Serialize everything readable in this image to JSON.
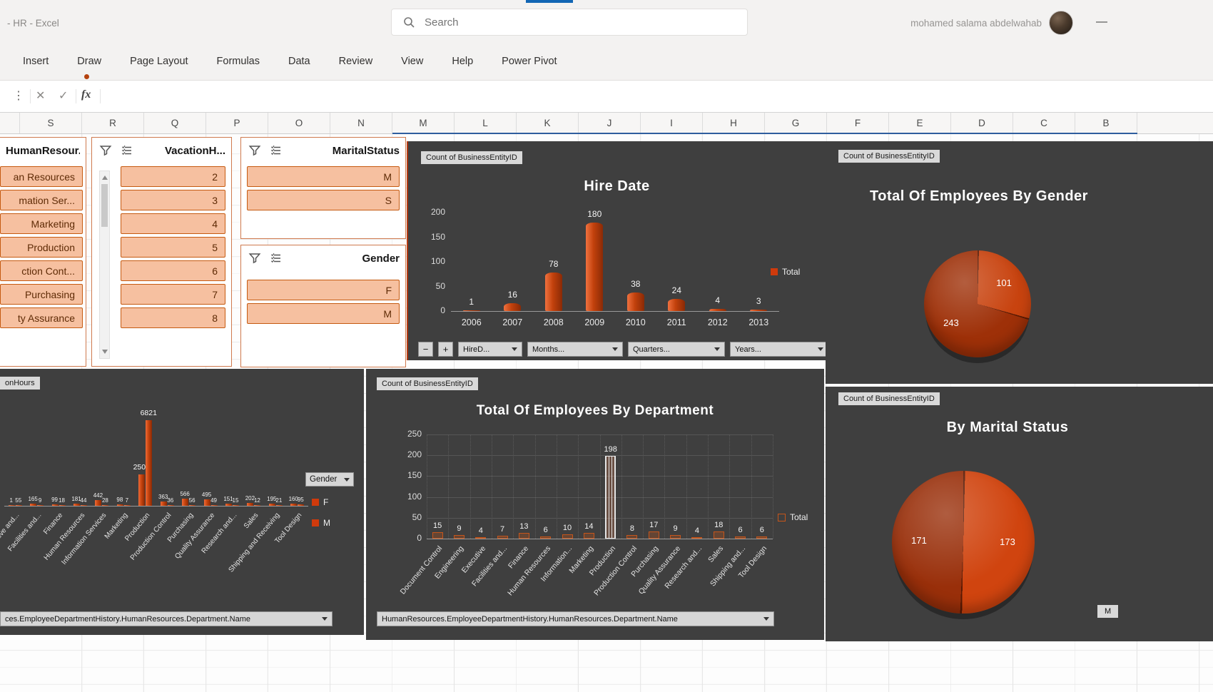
{
  "titlebar": {
    "app_title": "- HR - Excel",
    "search_placeholder": "Search",
    "user_name": "mohamed salama abdelwahab",
    "minimize_glyph": "—"
  },
  "ribbon": {
    "tabs": [
      "Insert",
      "Draw",
      "Page Layout",
      "Formulas",
      "Data",
      "Review",
      "View",
      "Help",
      "Power Pivot"
    ]
  },
  "formula_bar": {
    "dots_glyph": "⋮",
    "cancel_glyph": "✕",
    "enter_glyph": "✓",
    "fx_label": "fx"
  },
  "sheet": {
    "column_headers": [
      "S",
      "R",
      "Q",
      "P",
      "O",
      "N",
      "M",
      "L",
      "K",
      "J",
      "I",
      "H",
      "G",
      "F",
      "E",
      "D",
      "C",
      "B"
    ]
  },
  "slicers": [
    {
      "title": "HumanResour...",
      "items": [
        "an Resources",
        "mation Ser...",
        "Marketing",
        "Production",
        "ction Cont...",
        "Purchasing",
        "ty Assurance"
      ]
    },
    {
      "title": "VacationH...",
      "items": [
        "2",
        "3",
        "4",
        "5",
        "6",
        "7",
        "8"
      ]
    },
    {
      "title": "MaritalStatus",
      "items": [
        "M",
        "S"
      ]
    },
    {
      "title": "Gender",
      "items": [
        "F",
        "M"
      ]
    }
  ],
  "chart_data": [
    {
      "id": "hire-date",
      "type": "bar",
      "title": "Hire Date",
      "field_badge": "Count of BusinessEntityID",
      "categories": [
        "2006",
        "2007",
        "2008",
        "2009",
        "2010",
        "2011",
        "2012",
        "2013"
      ],
      "values": [
        1,
        16,
        78,
        180,
        38,
        24,
        4,
        3
      ],
      "ylim": [
        0,
        200
      ],
      "yticks": [
        200,
        150,
        100,
        50,
        0
      ],
      "legend": [
        {
          "label": "Total",
          "marker": "filled"
        }
      ],
      "bar_color": "#c2410c",
      "pivot_buttons": [
        "HireD...",
        "Months...",
        "Quarters...",
        "Years..."
      ]
    },
    {
      "id": "employees-by-gender",
      "type": "pie",
      "title": "Total Of Employees By Gender",
      "field_badge": "Count of BusinessEntityID",
      "labels": [
        "101",
        "243"
      ],
      "values": [
        101,
        243
      ],
      "colors": [
        "#c8430f",
        "#9e3008"
      ]
    },
    {
      "id": "employees-by-department",
      "type": "bar",
      "title": "Total Of Employees By Department",
      "field_badge": "Count of BusinessEntityID",
      "categories": [
        "Document Control",
        "Engineering",
        "Executive",
        "Facilities and...",
        "Finance",
        "Human Resources",
        "Information...",
        "Marketing",
        "Production",
        "Production Control",
        "Purchasing",
        "Quality Assurance",
        "Research and...",
        "Sales",
        "Shipping and...",
        "Tool Design"
      ],
      "values": [
        15,
        9,
        4,
        7,
        13,
        6,
        10,
        14,
        198,
        8,
        17,
        9,
        4,
        18,
        6,
        6
      ],
      "ylim": [
        0,
        250
      ],
      "yticks": [
        250,
        200,
        150,
        100,
        50,
        0
      ],
      "legend": [
        {
          "label": "Total",
          "marker": "hollow"
        }
      ],
      "highlight_index": 8,
      "grid": true,
      "axis_filter": "HumanResources.EmployeeDepartmentHistory.HumanResources.Department.Name"
    },
    {
      "id": "vacation-hours-by-department",
      "type": "bar",
      "field_badge": "onHours",
      "categories": [
        "Executive and...",
        "Facilities and...",
        "Finance",
        "Human Resources",
        "Information Services",
        "Marketing",
        "Production",
        "Production Control",
        "Purchasing",
        "Quality Assurance",
        "Research and...",
        "Sales",
        "Shipping and Receiving",
        "Tool Design"
      ],
      "series": [
        {
          "name": "F",
          "values": [
            1,
            165,
            99,
            181,
            442,
            98,
            2509,
            363,
            566,
            495,
            151,
            202,
            195,
            160
          ]
        },
        {
          "name": "M",
          "values": [
            55,
            9,
            18,
            44,
            28,
            7,
            6821,
            36,
            56,
            49,
            15,
            12,
            21,
            95
          ]
        }
      ],
      "filter_button": "Gender",
      "legend": [
        {
          "label": "F",
          "marker": "filled"
        },
        {
          "label": "M",
          "marker": "filled"
        }
      ],
      "axis_filter": "ces.EmployeeDepartmentHistory.HumanResources.Department.Name"
    },
    {
      "id": "by-marital-status",
      "type": "pie",
      "title": "By Marital Status",
      "field_badge": "Count of BusinessEntityID",
      "labels": [
        "173",
        "171"
      ],
      "values": [
        173,
        171
      ],
      "colors": [
        "#d0440f",
        "#992f0a"
      ]
    }
  ],
  "misc": {
    "cut_badge_label": "M"
  },
  "colors": {
    "chart_background": "#3f3f3f",
    "bar_orange": "#c2410c",
    "slicer_item_fill": "#f6c0a0",
    "slicer_item_border": "#c55a11",
    "badge_background": "#d9d9d9"
  }
}
